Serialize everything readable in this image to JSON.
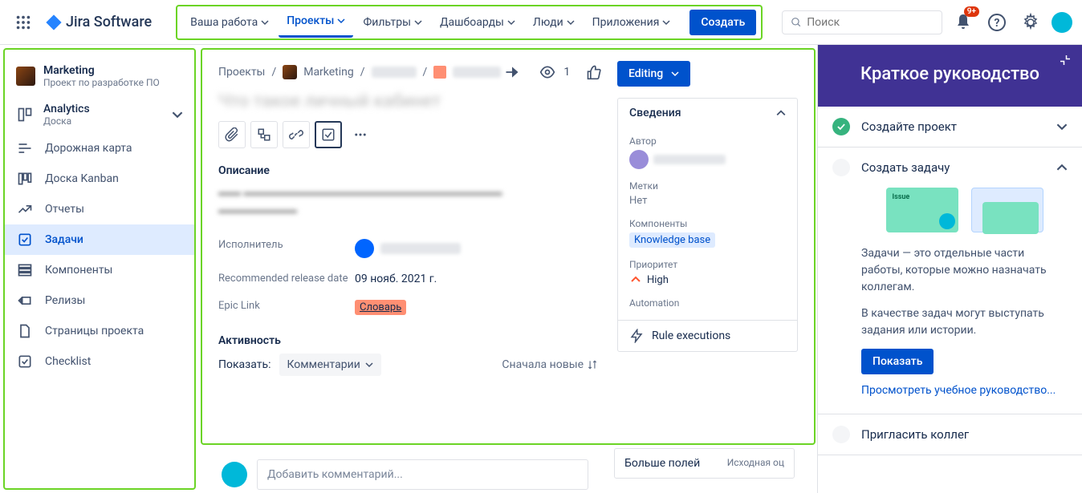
{
  "logo": "Jira Software",
  "nav": {
    "items": [
      "Ваша работа",
      "Проекты",
      "Фильтры",
      "Дашбоарды",
      "Люди",
      "Приложения"
    ],
    "active_index": 1,
    "create": "Создать"
  },
  "search_placeholder": "Поиск",
  "notif_badge": "9+",
  "sidebar": {
    "project_name": "Marketing",
    "project_type": "Проект по разработке ПО",
    "board_title": "Analytics",
    "board_sub": "Доска",
    "items": [
      {
        "label": "Дорожная карта",
        "icon": "roadmap"
      },
      {
        "label": "Доска Kanban",
        "icon": "board"
      },
      {
        "label": "Отчеты",
        "icon": "reports"
      },
      {
        "label": "Задачи",
        "icon": "issues",
        "selected": true
      },
      {
        "label": "Компоненты",
        "icon": "components"
      },
      {
        "label": "Релизы",
        "icon": "releases"
      },
      {
        "label": "Страницы проекта",
        "icon": "pages"
      },
      {
        "label": "Checklist",
        "icon": "checklist"
      }
    ]
  },
  "issue": {
    "breadcrumbs": {
      "projects": "Проекты",
      "project": "Marketing"
    },
    "watch_count": "1",
    "status": "Editing",
    "description_label": "Описание",
    "fields": {
      "assignee_label": "Исполнитель",
      "release_label": "Recommended release date",
      "release_value": "09 нояб. 2021 г.",
      "epic_label": "Epic Link",
      "epic_value": "Словарь"
    },
    "activity": {
      "title": "Активность",
      "show": "Показать:",
      "comments": "Комментарии",
      "sort": "Сначала новые"
    },
    "details": {
      "title": "Сведения",
      "author_label": "Автор",
      "labels_label": "Метки",
      "labels_value": "Нет",
      "components_label": "Компоненты",
      "components_value": "Knowledge base",
      "priority_label": "Приоритет",
      "priority_value": "High",
      "automation_label": "Automation",
      "automation_value": "Rule executions"
    },
    "more_fields": "Больше полей",
    "more_fields_sub": "Исходная оц",
    "comment_placeholder": "Добавить комментарий..."
  },
  "guide": {
    "title": "Краткое руководство",
    "steps": [
      {
        "title": "Создайте проект",
        "done": true
      },
      {
        "title": "Создать задачу",
        "done": false,
        "expanded": true
      },
      {
        "title": "Пригласить коллег",
        "done": false
      }
    ],
    "body_p1": "Задачи — это отдельные части работы, которые можно назначать коллегам.",
    "body_p2": "В качестве задач могут выступать задания или истории.",
    "show_btn": "Показать",
    "tutorial_link": "Просмотреть учебное руководство...",
    "issue_card_label": "Issue"
  }
}
